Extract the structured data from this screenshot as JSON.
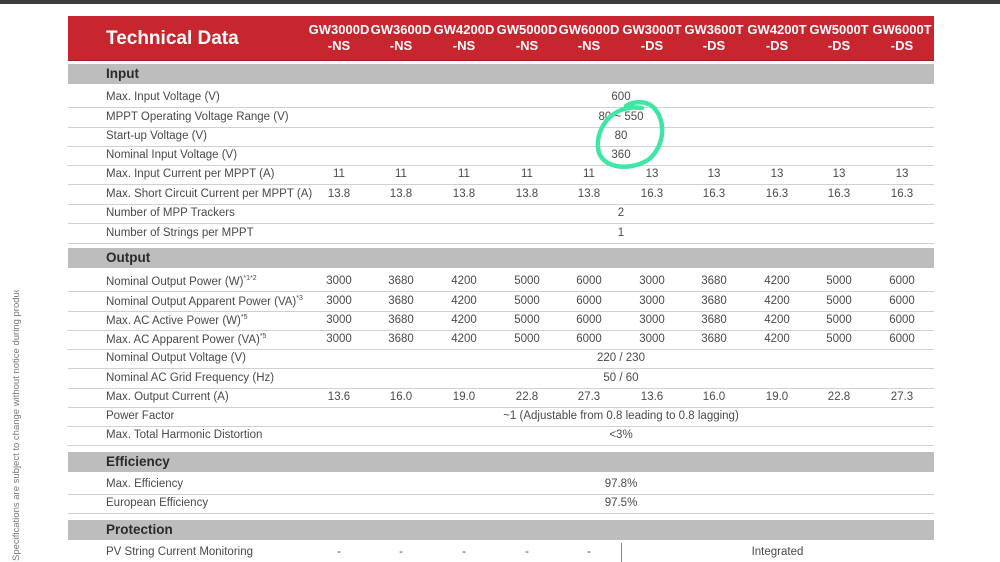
{
  "header": {
    "title": "Technical Data",
    "models": [
      [
        "GW3000D",
        "-NS"
      ],
      [
        "GW3600D",
        "-NS"
      ],
      [
        "GW4200D",
        "-NS"
      ],
      [
        "GW5000D",
        "-NS"
      ],
      [
        "GW6000D",
        "-NS"
      ],
      [
        "GW3000T",
        "-DS"
      ],
      [
        "GW3600T",
        "-DS"
      ],
      [
        "GW4200T",
        "-DS"
      ],
      [
        "GW5000T",
        "-DS"
      ],
      [
        "GW6000T",
        "-DS"
      ]
    ]
  },
  "side_note": "Specifications are subject to change without notice during product improving.",
  "sections": {
    "input": "Input",
    "output": "Output",
    "efficiency": "Efficiency",
    "protection": "Protection"
  },
  "rows": {
    "max_input_voltage": {
      "label": "Max. Input Voltage (V)",
      "value": "600"
    },
    "mppt_range": {
      "label": "MPPT Operating Voltage Range (V)",
      "value": "80 ~ 550"
    },
    "startup_voltage": {
      "label": "Start-up Voltage (V)",
      "value": "80"
    },
    "nominal_input_voltage": {
      "label": "Nominal Input Voltage (V)",
      "value": "360"
    },
    "max_input_current": {
      "label": "Max. Input Current per MPPT (A)",
      "values": [
        "11",
        "11",
        "11",
        "11",
        "11",
        "13",
        "13",
        "13",
        "13",
        "13"
      ]
    },
    "max_short_circuit": {
      "label": "Max. Short Circuit Current per MPPT (A)",
      "values": [
        "13.8",
        "13.8",
        "13.8",
        "13.8",
        "13.8",
        "16.3",
        "16.3",
        "16.3",
        "16.3",
        "16.3"
      ]
    },
    "mpp_trackers": {
      "label": "Number of MPP Trackers",
      "value": "2"
    },
    "strings_per_mppt": {
      "label": "Number of Strings per MPPT",
      "value": "1"
    },
    "nominal_output_power": {
      "label": "Nominal Output Power (W)",
      "note": "*1*2",
      "values": [
        "3000",
        "3680",
        "4200",
        "5000",
        "6000",
        "3000",
        "3680",
        "4200",
        "5000",
        "6000"
      ]
    },
    "nominal_apparent_power": {
      "label": "Nominal Output Apparent Power (VA)",
      "note": "*3",
      "values": [
        "3000",
        "3680",
        "4200",
        "5000",
        "6000",
        "3000",
        "3680",
        "4200",
        "5000",
        "6000"
      ]
    },
    "max_active_power": {
      "label": "Max. AC Active Power (W)",
      "note": "*5",
      "values": [
        "3000",
        "3680",
        "4200",
        "5000",
        "6000",
        "3000",
        "3680",
        "4200",
        "5000",
        "6000"
      ]
    },
    "max_apparent_power": {
      "label": "Max. AC Apparent Power (VA)",
      "note": "*5",
      "values": [
        "3000",
        "3680",
        "4200",
        "5000",
        "6000",
        "3000",
        "3680",
        "4200",
        "5000",
        "6000"
      ]
    },
    "nominal_output_voltage": {
      "label": "Nominal Output Voltage (V)",
      "value": "220 / 230"
    },
    "grid_frequency": {
      "label": "Nominal AC Grid Frequency (Hz)",
      "value": "50 / 60"
    },
    "max_output_current": {
      "label": "Max. Output Current (A)",
      "values": [
        "13.6",
        "16.0",
        "19.0",
        "22.8",
        "27.3",
        "13.6",
        "16.0",
        "19.0",
        "22.8",
        "27.3"
      ]
    },
    "power_factor": {
      "label": "Power Factor",
      "value": "~1 (Adjustable from 0.8 leading to 0.8 lagging)"
    },
    "thd": {
      "label": "Max. Total Harmonic Distortion",
      "value": "<3%"
    },
    "max_efficiency": {
      "label": "Max. Efficiency",
      "value": "97.8%"
    },
    "european_efficiency": {
      "label": "European Efficiency",
      "value": "97.5%"
    },
    "pv_string_monitoring": {
      "label": "PV String Current Monitoring",
      "values_left": [
        "-",
        "-",
        "-",
        "-",
        "-"
      ],
      "value_right": "Integrated"
    }
  },
  "colors": {
    "header_red": "#c8262e",
    "section_gray": "#bdbdbd",
    "highlight_marker": "#3fe6a4"
  }
}
